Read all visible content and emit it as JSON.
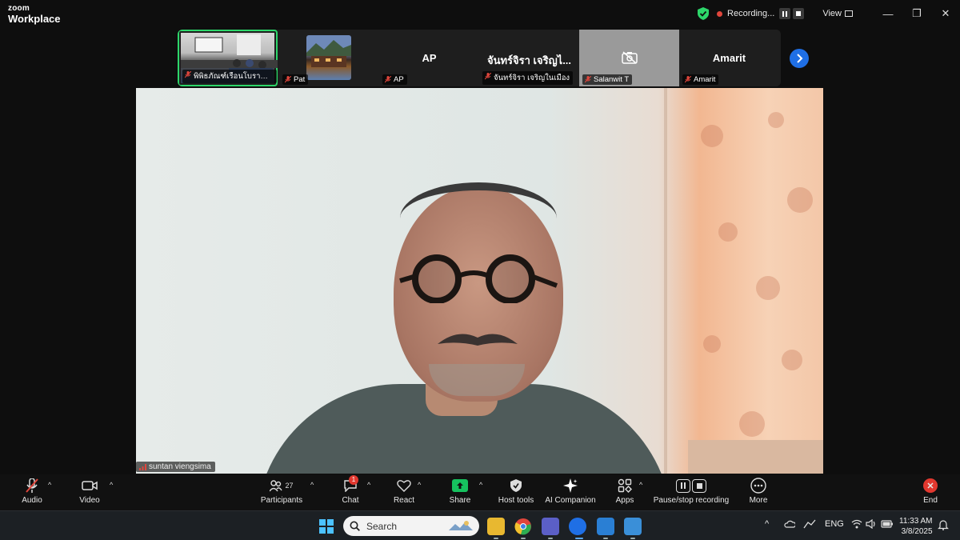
{
  "app": {
    "brand_small": "zoom",
    "brand_large": "Workplace"
  },
  "titlebar": {
    "recording_label": "Recording...",
    "view_label": "View",
    "minimize_glyph": "—",
    "restore_glyph": "❐",
    "close_glyph": "✕"
  },
  "strip": {
    "tiles": [
      {
        "label": "พิพิธภัณฑ์เรือนโบราณล้า...",
        "big": ""
      },
      {
        "label": "Pat",
        "big": ""
      },
      {
        "label": "AP",
        "big": "AP"
      },
      {
        "label": "จันทร์จิรา เจริญในเมือง",
        "big": "จันทร์จิรา เจริญไ..."
      },
      {
        "label": "Salanwit T",
        "big": ""
      },
      {
        "label": "Amarit",
        "big": "Amarit"
      }
    ]
  },
  "main_video": {
    "speaker_name": "suntan viengsima"
  },
  "toolbar": {
    "audio": "Audio",
    "video": "Video",
    "participants": "Participants",
    "participants_count": "27",
    "chat": "Chat",
    "chat_badge": "1",
    "react": "React",
    "share": "Share",
    "host_tools": "Host tools",
    "ai_companion": "AI Companion",
    "apps": "Apps",
    "pause_stop": "Pause/stop recording",
    "more": "More",
    "end": "End"
  },
  "taskbar": {
    "search_placeholder": "Search",
    "lang": "ENG",
    "time": "11:33 AM",
    "date": "3/8/2025"
  },
  "colors": {
    "accent_green": "#2dd66a",
    "record_red": "#e0463c",
    "share_green": "#16c25f",
    "strip_next_blue": "#1f6fe5"
  }
}
